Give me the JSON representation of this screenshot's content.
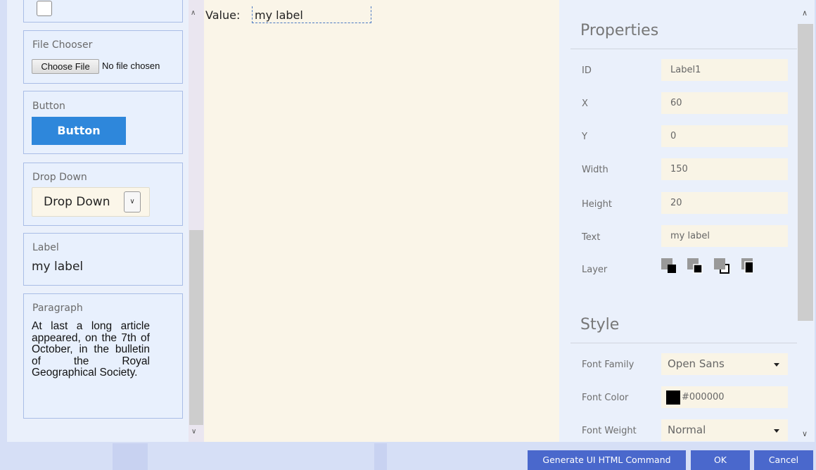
{
  "palette": {
    "file_chooser": {
      "title": "File Chooser",
      "button": "Choose File",
      "status": "No file chosen"
    },
    "button": {
      "title": "Button",
      "demo": "Button"
    },
    "dropdown": {
      "title": "Drop Down",
      "demo": "Drop Down"
    },
    "label": {
      "title": "Label",
      "demo": "my label"
    },
    "paragraph": {
      "title": "Paragraph",
      "text": "At last a long article appeared, on the 7th of October, in the bulletin of the Royal Geographical Society."
    }
  },
  "canvas": {
    "value_label": "Value:",
    "label_text": "my label"
  },
  "properties": {
    "title": "Properties",
    "rows": [
      {
        "label": "ID",
        "value": "Label1"
      },
      {
        "label": "X",
        "value": "60"
      },
      {
        "label": "Y",
        "value": "0"
      },
      {
        "label": "Width",
        "value": "150"
      },
      {
        "label": "Height",
        "value": "20"
      },
      {
        "label": "Text",
        "value": "my label"
      }
    ],
    "layer_label": "Layer",
    "layer_icons": [
      "send-to-back-icon",
      "send-backward-icon",
      "bring-forward-icon",
      "bring-to-front-icon"
    ]
  },
  "style": {
    "title": "Style",
    "font_family": {
      "label": "Font Family",
      "value": "Open Sans"
    },
    "font_color": {
      "label": "Font Color",
      "value": "#000000",
      "swatch": "#000000"
    },
    "font_weight": {
      "label": "Font Weight",
      "value": "Normal"
    }
  },
  "buttons": {
    "generate": "Generate UI HTML Command",
    "ok": "OK",
    "cancel": "Cancel"
  },
  "colors": {
    "accent": "#4a68cc",
    "demo_button": "#2e87db",
    "canvas_bg": "#faf5e8",
    "field_bg": "#f9f4e6"
  }
}
